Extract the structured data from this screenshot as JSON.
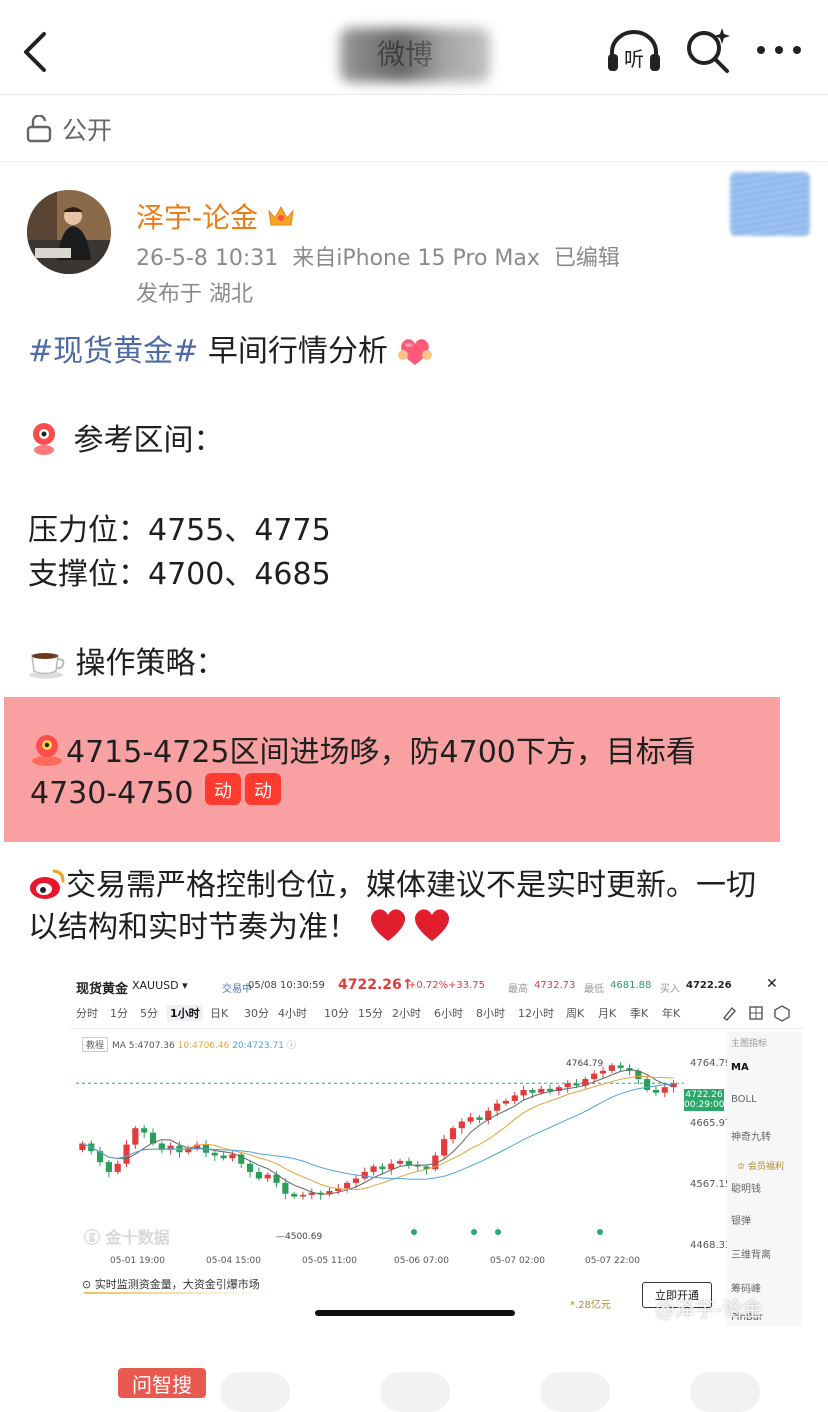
{
  "header": {
    "title": "微博",
    "listen_label": "听",
    "icons": [
      "back-chevron-icon",
      "listen-headphones-icon",
      "ai-search-icon",
      "more-dots-icon"
    ]
  },
  "visibility": {
    "label": "公开"
  },
  "author": {
    "name": "泽宇-论金",
    "timestamp": "26-5-8 10:31",
    "source": "来自iPhone 15 Pro Max",
    "edited": "已编辑",
    "location": "发布于 湖北"
  },
  "post": {
    "hashtag": "#现货黄金#",
    "title_rest": "早间行情分析",
    "ref_heading": "参考区间：",
    "resistance": "压力位：4755、4775",
    "support": "支撑位：4700、4685",
    "strategy_heading": "操作策略：",
    "strategy_line1": "4715-4725区间进场哆，防4700下方，目标看",
    "strategy_line2": "4730-4750",
    "warn_line1": "交易需严格控制仓位，媒体建议不是实时更新。一切",
    "warn_line2": "以结构和实时节奏为准！"
  },
  "chart_card": {
    "name": "现货黄金",
    "symbol": "XAUUSD",
    "status": "交易中",
    "time": "05/08 10:30:59",
    "price": "4722.26",
    "change_pct": "+0.72%",
    "change": "+33.75",
    "high_label": "最高",
    "high": "4732.73",
    "low_label": "最低",
    "low": "4681.88",
    "buy_label": "买入",
    "buy": "4722.26",
    "close_icon": "close-icon",
    "timeframes": [
      "分时",
      "1分",
      "5分",
      "1小时",
      "日K",
      "30分",
      "4小时",
      "10分",
      "15分",
      "2小时",
      "6小时",
      "8小时",
      "12小时",
      "周K",
      "月K",
      "季K",
      "年K"
    ],
    "active_timeframe": "1小时",
    "tutorial": "教程",
    "ma_text": "MA 5:4707.36 10:4706.46 20:4723.71",
    "ma5": "MA 5:4707.36",
    "ma10": "10:4706.46",
    "ma20": "20:4723.71",
    "side_title": "主图指标",
    "side_items": [
      "MA",
      "BOLL",
      "神奇九转",
      "聪明钱",
      "银弹",
      "三维背离",
      "筹码峰",
      "PinBar"
    ],
    "member_badge": "会员福利",
    "price_tag": "4722.26",
    "countdown": "00:29:00",
    "y_ticks": [
      "4764.79",
      "4665.97",
      "4567.15",
      "4468.33"
    ],
    "hi_label": "4764.79",
    "lo_label": "4500.69",
    "x_labels": [
      "05-01 19:00",
      "05-04 15:00",
      "05-05 11:00",
      "05-06 07:00",
      "05-07 02:00",
      "05-07 22:00"
    ],
    "watermark": "金十数据",
    "promo": "实时监测资金量，大资金引爆市场",
    "promo_amount": "*.28亿元",
    "promo_button": "立即开通"
  },
  "chart_data": {
    "type": "candlestick",
    "ylim": [
      4468.33,
      4764.79
    ],
    "candles": [
      [
        4600,
        4612
      ],
      [
        4612,
        4598
      ],
      [
        4598,
        4578
      ],
      [
        4578,
        4560
      ],
      [
        4560,
        4575
      ],
      [
        4575,
        4610
      ],
      [
        4610,
        4640
      ],
      [
        4640,
        4632
      ],
      [
        4632,
        4612
      ],
      [
        4612,
        4600
      ],
      [
        4600,
        4608
      ],
      [
        4608,
        4596
      ],
      [
        4596,
        4604
      ],
      [
        4604,
        4610
      ],
      [
        4610,
        4595
      ],
      [
        4595,
        4590
      ],
      [
        4590,
        4585
      ],
      [
        4585,
        4592
      ],
      [
        4592,
        4575
      ],
      [
        4575,
        4560
      ],
      [
        4560,
        4548
      ],
      [
        4548,
        4555
      ],
      [
        4555,
        4540
      ],
      [
        4540,
        4520
      ],
      [
        4520,
        4515
      ],
      [
        4515,
        4518
      ],
      [
        4518,
        4522
      ],
      [
        4522,
        4519
      ],
      [
        4519,
        4525
      ],
      [
        4525,
        4530
      ],
      [
        4530,
        4540
      ],
      [
        4540,
        4548
      ],
      [
        4548,
        4560
      ],
      [
        4560,
        4570
      ],
      [
        4570,
        4565
      ],
      [
        4565,
        4575
      ],
      [
        4575,
        4580
      ],
      [
        4580,
        4572
      ],
      [
        4572,
        4570
      ],
      [
        4570,
        4565
      ],
      [
        4565,
        4590
      ],
      [
        4590,
        4620
      ],
      [
        4620,
        4640
      ],
      [
        4640,
        4652
      ],
      [
        4652,
        4660
      ],
      [
        4660,
        4655
      ],
      [
        4655,
        4672
      ],
      [
        4672,
        4685
      ],
      [
        4685,
        4690
      ],
      [
        4690,
        4700
      ],
      [
        4700,
        4710
      ],
      [
        4710,
        4705
      ],
      [
        4705,
        4712
      ],
      [
        4712,
        4708
      ],
      [
        4708,
        4715
      ],
      [
        4715,
        4722
      ],
      [
        4722,
        4718
      ],
      [
        4718,
        4730
      ],
      [
        4730,
        4740
      ],
      [
        4740,
        4745
      ],
      [
        4745,
        4755
      ],
      [
        4755,
        4750
      ],
      [
        4750,
        4745
      ],
      [
        4745,
        4730
      ],
      [
        4730,
        4710
      ],
      [
        4710,
        4705
      ],
      [
        4705,
        4715
      ],
      [
        4715,
        4722
      ]
    ],
    "annotations": [
      {
        "label": "4764.79",
        "value": 4764.79
      },
      {
        "label": "4500.69",
        "value": 4500.69
      }
    ]
  },
  "footer": {
    "watermark": "@泽宇-论金",
    "ask_button": "问智搜"
  }
}
